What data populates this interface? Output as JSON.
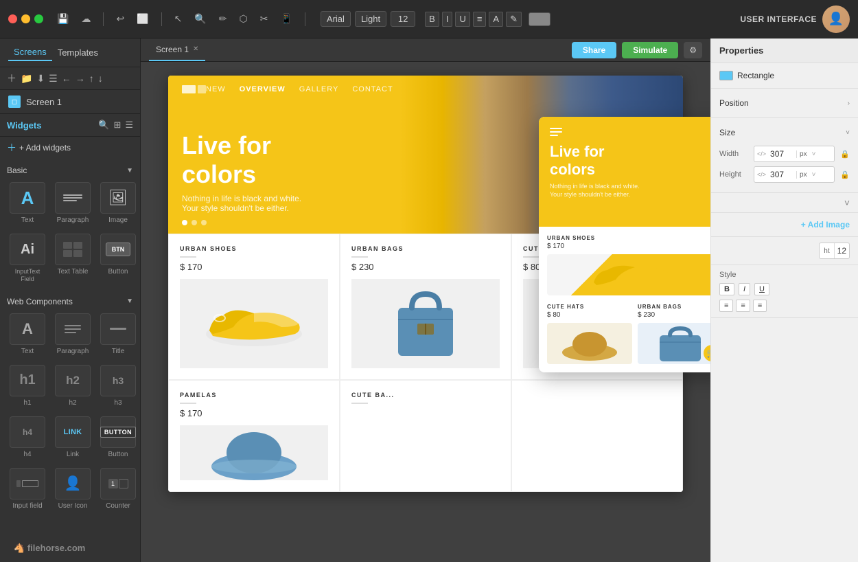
{
  "app": {
    "title": "USER INTERFACE",
    "traffic_lights": [
      "red",
      "yellow",
      "green"
    ]
  },
  "toolbar": {
    "font_name": "Arial",
    "font_weight": "Light",
    "font_size": "12",
    "bold": "B",
    "italic": "I",
    "underline": "U"
  },
  "left_panel": {
    "tabs": [
      {
        "label": "Screens",
        "active": true
      },
      {
        "label": "Templates",
        "active": false
      }
    ],
    "screens": [
      {
        "name": "Screen 1"
      }
    ],
    "widgets": {
      "title": "Widgets",
      "add_label": "+ Add widgets",
      "groups": [
        {
          "title": "Basic",
          "items": [
            {
              "label": "Text",
              "icon": "A"
            },
            {
              "label": "Paragraph",
              "icon": "¶"
            },
            {
              "label": "Image",
              "icon": "🖼"
            },
            {
              "label": "InputText\nField",
              "icon": "Ai"
            },
            {
              "label": "Text Table",
              "icon": "⊞"
            },
            {
              "label": "Button",
              "icon": "▣"
            }
          ]
        },
        {
          "title": "Web Components",
          "items": [
            {
              "label": "Text",
              "icon": "A"
            },
            {
              "label": "Paragraph",
              "icon": "≡"
            },
            {
              "label": "Title",
              "icon": "—"
            },
            {
              "label": "h1",
              "icon": "h1"
            },
            {
              "label": "h2",
              "icon": "h2"
            },
            {
              "label": "h3",
              "icon": "h3"
            },
            {
              "label": "h4",
              "icon": "h4"
            },
            {
              "label": "Link",
              "icon": "LINK"
            },
            {
              "label": "Button",
              "icon": "BUTTON"
            },
            {
              "label": "Input field",
              "icon": "□"
            },
            {
              "label": "User Icon",
              "icon": "👤"
            },
            {
              "label": "Counter",
              "icon": "1□"
            }
          ]
        }
      ]
    }
  },
  "canvas": {
    "tab_name": "Screen 1",
    "share_btn": "Share",
    "simulate_btn": "Simulate",
    "preview": {
      "hero": {
        "nav_links": [
          "NEW",
          "OVERVIEW",
          "GALLERY",
          "CONTACT"
        ],
        "active_nav": "OVERVIEW",
        "title_line1": "Live for",
        "title_line2": "colors",
        "subtitle_line1": "Nothing in life is black and white.",
        "subtitle_line2": "Your style shouldn't be either."
      },
      "products": [
        {
          "category": "URBAN SHOES",
          "price": "$ 170",
          "type": "shoe"
        },
        {
          "category": "URBAN BAGS",
          "price": "$ 230",
          "type": "bag"
        },
        {
          "category": "CUTE HA...",
          "price": "$ 80",
          "type": "hat"
        },
        {
          "category": "PAMELAS",
          "price": "$ 170",
          "type": "hat2"
        },
        {
          "category": "CUTE BA...",
          "price": "",
          "type": "bag2"
        }
      ]
    },
    "mobile_preview": {
      "hero": {
        "title_line1": "Live for",
        "title_line2": "colors",
        "subtitle_line1": "Nothing in life is black and white.",
        "subtitle_line2": "Your style shouldn't be either."
      },
      "products": [
        {
          "category": "URBAN SHOES",
          "price": "$ 170",
          "type": "shoe"
        },
        {
          "category": "CUTE HATS",
          "price": "$ 80",
          "type": "hat"
        },
        {
          "category": "URBAN BAGS",
          "price": "$ 230",
          "type": "bag"
        }
      ]
    }
  },
  "right_panel": {
    "title": "Properties",
    "type_label": "Rectangle",
    "sections": [
      {
        "label": "Position",
        "expanded": false
      },
      {
        "label": "Size",
        "expanded": true
      }
    ],
    "width": {
      "label": "Width",
      "value": "307",
      "unit": "px"
    },
    "height": {
      "label": "Height",
      "value": "307",
      "unit": "px"
    },
    "font_size_label": "12",
    "add_image_btn": "+ Add Image",
    "style": {
      "bold": "B",
      "italic": "I",
      "underline": "U"
    }
  },
  "bottom_logo": "filehorse.com"
}
